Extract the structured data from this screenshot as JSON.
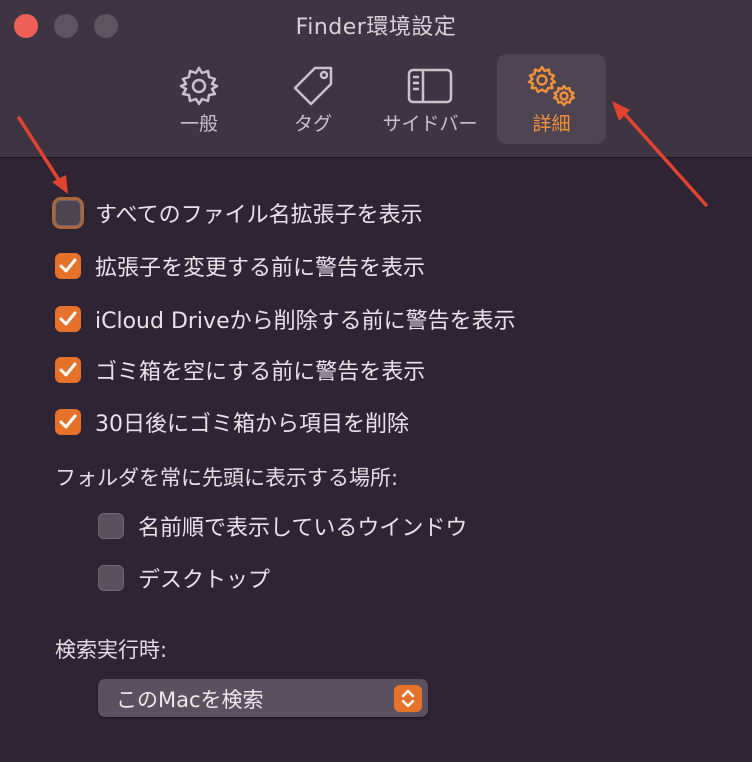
{
  "window": {
    "title": "Finder環境設定"
  },
  "tabs": [
    {
      "label": "一般",
      "icon": "gear-icon"
    },
    {
      "label": "タグ",
      "icon": "tag-icon"
    },
    {
      "label": "サイドバー",
      "icon": "sidebar-icon"
    },
    {
      "label": "詳細",
      "icon": "gears-icon",
      "selected": true
    }
  ],
  "options": [
    {
      "label": "すべてのファイル名拡張子を表示",
      "checked": false
    },
    {
      "label": "拡張子を変更する前に警告を表示",
      "checked": true
    },
    {
      "label": "iCloud Driveから削除する前に警告を表示",
      "checked": true
    },
    {
      "label": "ゴミ箱を空にする前に警告を表示",
      "checked": true
    },
    {
      "label": "30日後にゴミ箱から項目を削除",
      "checked": true
    }
  ],
  "folders_on_top": {
    "heading": "フォルダを常に先頭に表示する場所:",
    "items": [
      {
        "label": "名前順で表示しているウインドウ",
        "checked": false
      },
      {
        "label": "デスクトップ",
        "checked": false
      }
    ]
  },
  "search": {
    "heading": "検索実行時:",
    "selected": "このMacを検索"
  },
  "colors": {
    "accent": "#e6712a",
    "annotation_arrow": "#e0432f"
  }
}
